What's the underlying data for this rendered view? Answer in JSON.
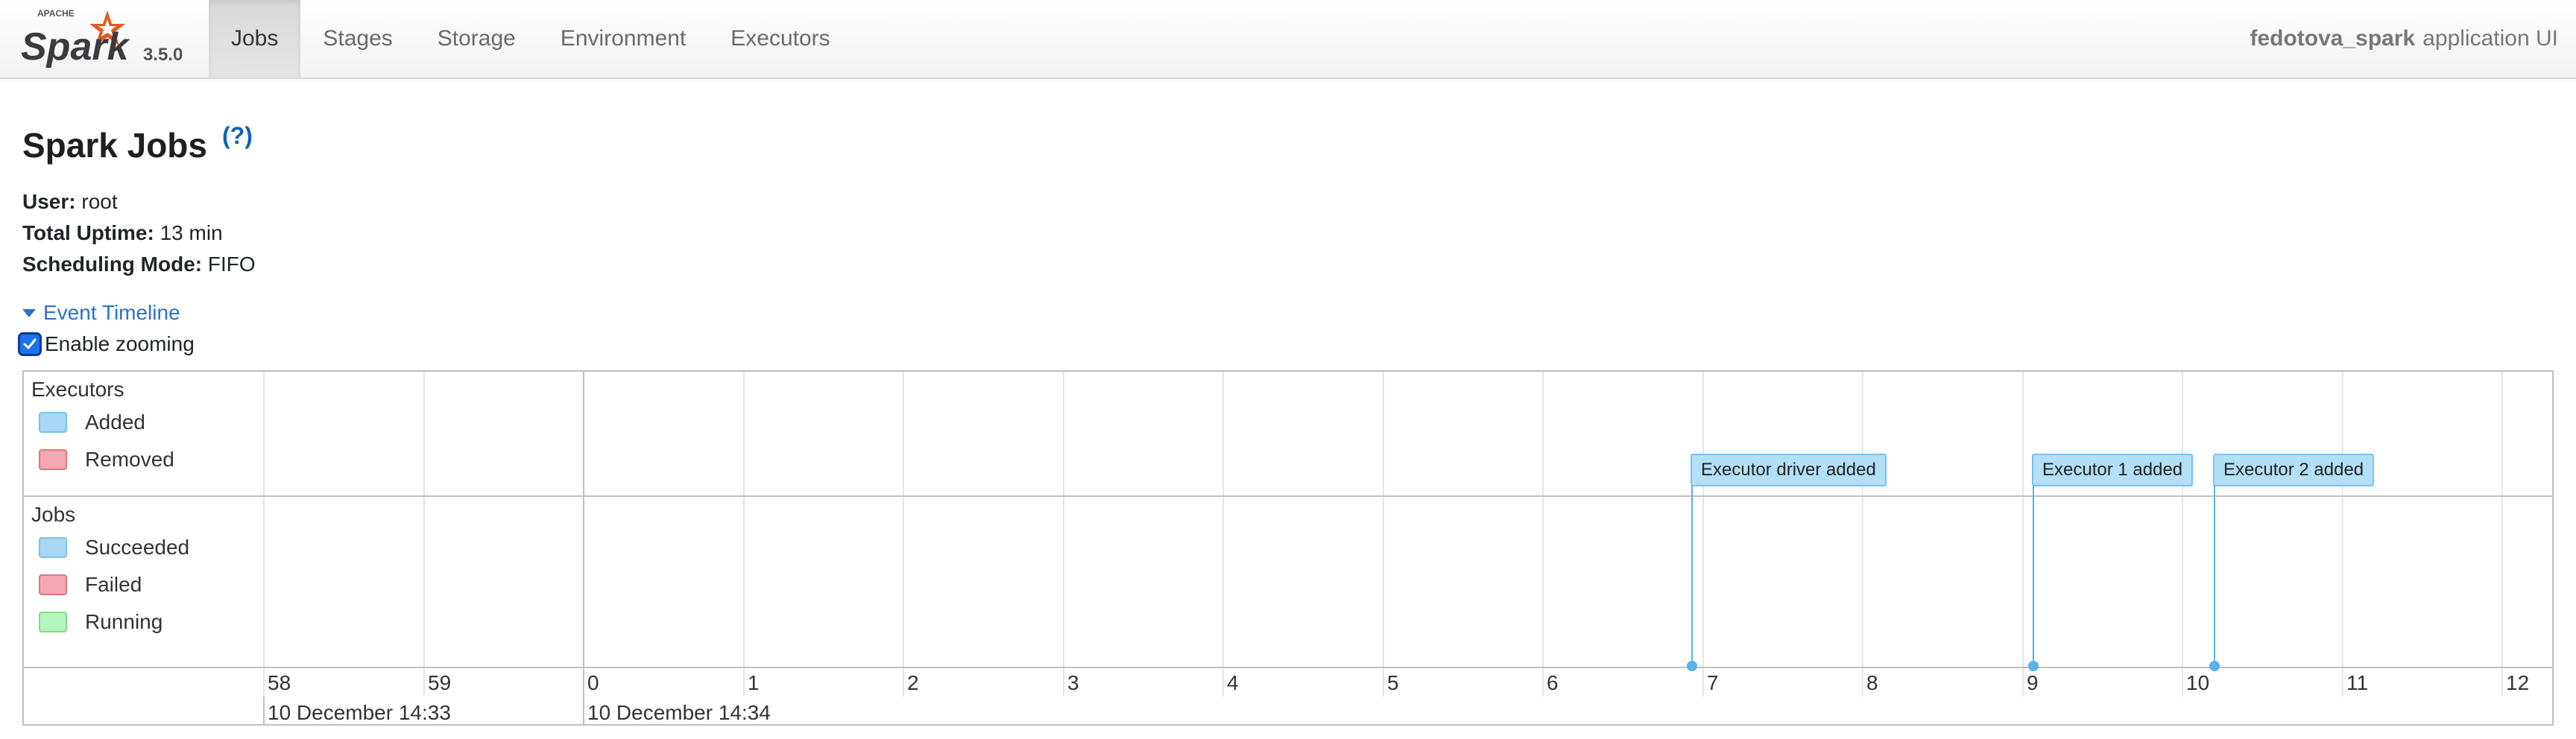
{
  "navbar": {
    "brand_version": "3.5.0",
    "tabs": [
      {
        "label": "Jobs",
        "active": true
      },
      {
        "label": "Stages",
        "active": false
      },
      {
        "label": "Storage",
        "active": false
      },
      {
        "label": "Environment",
        "active": false
      },
      {
        "label": "Executors",
        "active": false
      }
    ],
    "app_name": "fedotova_spark",
    "app_suffix": "application UI"
  },
  "page": {
    "title": "Spark Jobs",
    "help": "(?)",
    "summary": {
      "user_label": "User:",
      "user_value": "root",
      "uptime_label": "Total Uptime:",
      "uptime_value": "13 min",
      "mode_label": "Scheduling Mode:",
      "mode_value": "FIFO"
    },
    "timeline_toggle": "Event Timeline",
    "zoom_label": "Enable zooming",
    "zoom_checked": true
  },
  "timeline": {
    "executors_group": "Executors",
    "executors_legend": [
      {
        "label": "Added",
        "color": "#a8d8f5"
      },
      {
        "label": "Removed",
        "color": "#f4a7b0"
      }
    ],
    "jobs_group": "Jobs",
    "jobs_legend": [
      {
        "label": "Succeeded",
        "color": "#a8d8f5"
      },
      {
        "label": "Failed",
        "color": "#f4a7b0"
      },
      {
        "label": "Running",
        "color": "#b6f5bd"
      }
    ],
    "minor_ticks": [
      "58",
      "59",
      "0",
      "1",
      "2",
      "3",
      "4",
      "5",
      "6",
      "7",
      "8",
      "9",
      "10",
      "11",
      "12"
    ],
    "major_labels": [
      "10 December 14:33",
      "10 December 14:34"
    ],
    "events": [
      {
        "label": "Executor driver added"
      },
      {
        "label": "Executor 1 added"
      },
      {
        "label": "Executor 2 added"
      }
    ]
  }
}
